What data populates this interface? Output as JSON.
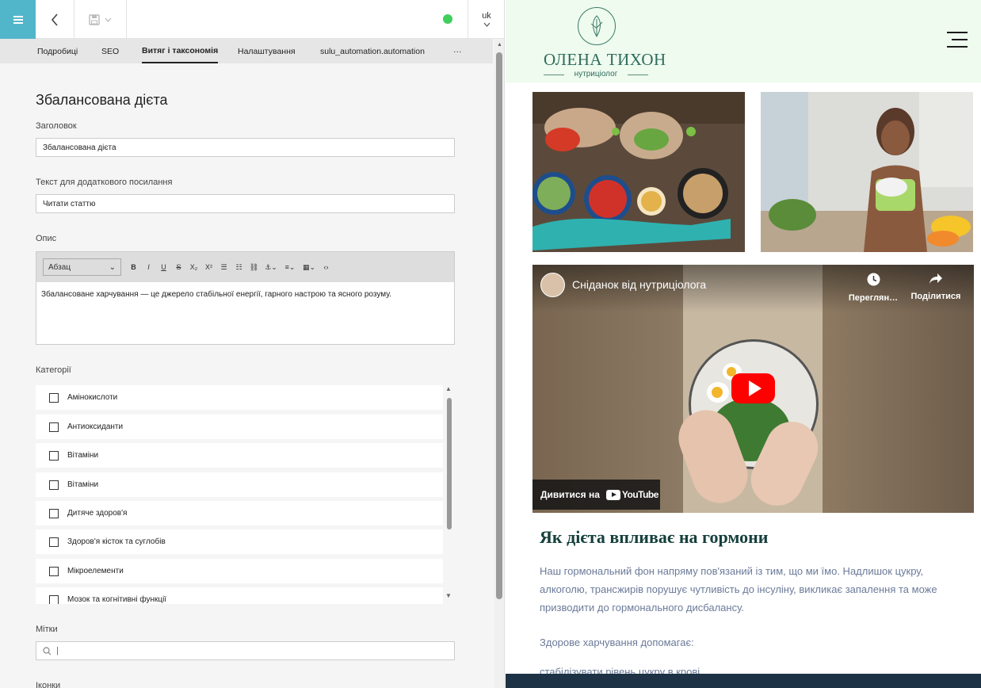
{
  "toolbar": {
    "status_color": "#3fcf5b",
    "locale": "uk"
  },
  "tabs": [
    {
      "label": "Подробиці"
    },
    {
      "label": "SEO"
    },
    {
      "label": "Витяг і таксономія"
    },
    {
      "label": "Налаштування"
    },
    {
      "label": "sulu_automation.automation"
    },
    {
      "label": "···"
    }
  ],
  "form": {
    "page_title": "Збалансована дієта",
    "title_label": "Заголовок",
    "title_value": "Збалансована дієта",
    "link_text_label": "Текст для додаткового посилання",
    "link_text_value": "Читати статтю",
    "description_label": "Опис",
    "editor_format": "Абзац",
    "editor_text": "Збалансоване харчування — це джерело стабільної енергії, гарного настрою та ясного розуму.",
    "categories_label": "Категорії",
    "categories": [
      "Амінокислоти",
      "Антиоксиданти",
      "Вітаміни",
      "Вітаміни",
      "Дитяче здоров'я",
      "Здоров'я кісток та суглобів",
      "Мікроелементи",
      "Мозок та когнітивні функції"
    ],
    "tags_label": "Мітки",
    "icons_label": "Іконки"
  },
  "preview": {
    "logo_name": "ОЛЕНА ТИХОН",
    "logo_sub": "нутриціолог",
    "video_title": "Сніданок від нутриціолога",
    "video_watch_later": "Переглян…",
    "video_share": "Поділитися",
    "video_watch_on": "Дивитися на",
    "youtube_brand": "YouTube",
    "article_heading": "Як дієта впливає на гормони",
    "article_paragraph": "Наш гормональний фон напряму пов'язаний із тим, що ми їмо. Надлишок цукру, алкоголю, трансжирів порушує чутливість до інсуліну, викликає запалення та може призводити до гормонального дисбалансу.",
    "article_intro": "Здорове харчування допомагає:",
    "article_item": "стабілізувати рівень цукру в крові"
  }
}
